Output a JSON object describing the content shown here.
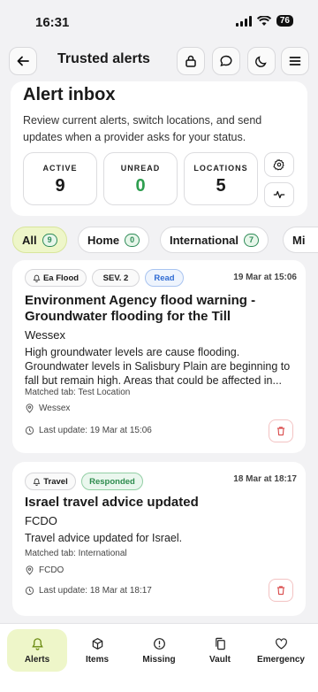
{
  "status": {
    "time": "16:31",
    "battery": "76"
  },
  "header": {
    "title": "Trusted alerts"
  },
  "inbox": {
    "title": "Alert inbox",
    "description": "Review current alerts, switch locations, and send updates when a provider asks for your status.",
    "stats": [
      {
        "label": "ACTIVE",
        "value": "9",
        "color": "#111111"
      },
      {
        "label": "UNREAD",
        "value": "0",
        "color": "#2e9e4f"
      },
      {
        "label": "LOCATIONS",
        "value": "5",
        "color": "#111111"
      }
    ]
  },
  "filters": [
    {
      "label": "All",
      "count": "9",
      "active": true
    },
    {
      "label": "Home",
      "count": "0"
    },
    {
      "label": "International",
      "count": "7"
    },
    {
      "label": "Mi"
    }
  ],
  "alerts": [
    {
      "category": "Ea Flood",
      "category_icon": "bell-icon",
      "severity": "SEV. 2",
      "status": "Read",
      "date": "19 Mar at 15:06",
      "title": "Environment Agency flood warning - Groundwater flooding for the Till",
      "source": "Wessex",
      "body": "High groundwater levels are cause flooding. Groundwater levels in Salisbury Plain are beginning to fall but remain high. Areas that could be affected in...",
      "matched": "Matched tab: Test Location",
      "location": "Wessex",
      "last_update": "Last update: 19 Mar at 15:06"
    },
    {
      "category": "Travel",
      "category_icon": "bell-icon",
      "status": "Responded",
      "date": "18 Mar at 18:17",
      "title": "Israel travel advice updated",
      "source": "FCDO",
      "body": "Travel advice updated for Israel.",
      "matched": "Matched tab: International",
      "location": "FCDO",
      "last_update": "Last update: 18 Mar at 18:17"
    }
  ],
  "tabs": [
    {
      "label": "Alerts",
      "icon": "bell-icon",
      "active": true
    },
    {
      "label": "Items",
      "icon": "box-icon"
    },
    {
      "label": "Missing",
      "icon": "alert-circle-icon"
    },
    {
      "label": "Vault",
      "icon": "files-icon"
    },
    {
      "label": "Emergency",
      "icon": "heart-icon"
    }
  ]
}
